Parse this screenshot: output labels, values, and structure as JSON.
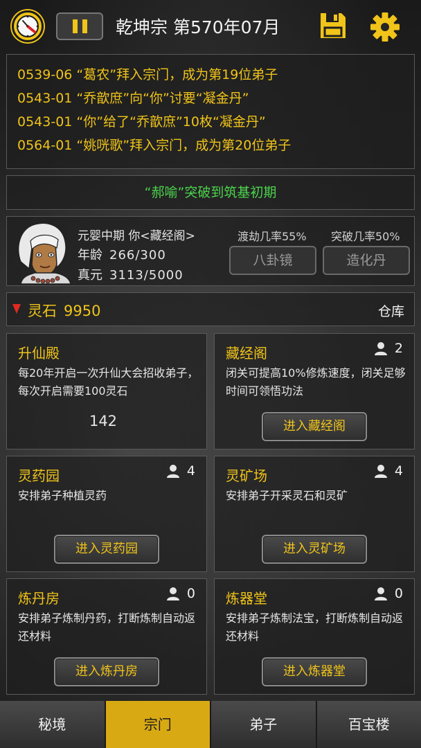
{
  "topbar": {
    "title": "乾坤宗 第570年07月",
    "icons": {
      "clock": "clock-icon",
      "pause": "pause-icon",
      "save": "save-icon",
      "settings": "gear-icon"
    }
  },
  "log": [
    "0539-06 “葛农”拜入宗门，成为第19位弟子",
    "0543-01 “乔歆庶”向“你”讨要“凝金丹”",
    "0543-01 “你”给了“乔歆庶”10枚“凝金丹”",
    "0564-01 “姚咣歌”拜入宗门，成为第20位弟子"
  ],
  "notice": "“郝喻”突破到筑基初期",
  "player": {
    "rank": "元婴中期 你<藏经阁>",
    "age_label": "年龄",
    "age_value": "266/300",
    "yuan_label": "真元",
    "yuan_value": "3113/5000",
    "tribulation_rate": "渡劫几率55%",
    "breakthrough_rate": "突破几率50%",
    "btn_bagua": "八卦镜",
    "btn_zaohua": "造化丹"
  },
  "stone": {
    "label": "灵石",
    "value": "9950",
    "storage": "仓库"
  },
  "cards": [
    {
      "title": "升仙殿",
      "desc": "每20年开启一次升仙大会招收弟子，每次开启需要100灵石",
      "number": "142"
    },
    {
      "title": "藏经阁",
      "count": "2",
      "desc": "闭关可提高10%修炼速度，闭关足够时间可领悟功法",
      "button": "进入藏经阁"
    },
    {
      "title": "灵药园",
      "count": "4",
      "desc": "安排弟子种植灵药",
      "button": "进入灵药园"
    },
    {
      "title": "灵矿场",
      "count": "4",
      "desc": "安排弟子开采灵石和灵矿",
      "button": "进入灵矿场"
    },
    {
      "title": "炼丹房",
      "count": "0",
      "desc": "安排弟子炼制丹药，打断炼制自动返还材料",
      "button": "进入炼丹房"
    },
    {
      "title": "炼器堂",
      "count": "0",
      "desc": "安排弟子炼制法宝，打断炼制自动返还材料",
      "button": "进入炼器堂"
    }
  ],
  "nav": [
    "秘境",
    "宗门",
    "弟子",
    "百宝楼"
  ],
  "colors": {
    "accent": "#f0c419",
    "notice": "#4cd34c",
    "arrow": "#e02b20",
    "nav_active": "#d9a913"
  }
}
